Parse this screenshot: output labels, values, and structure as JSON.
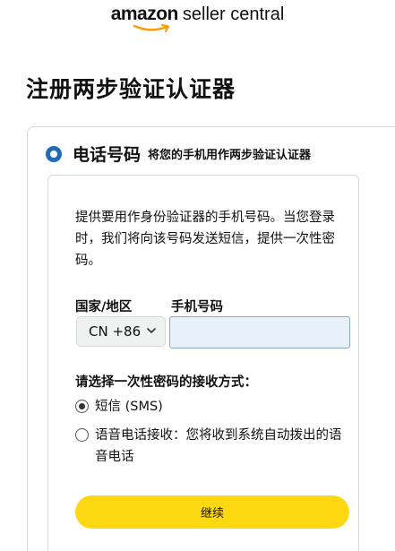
{
  "logo": {
    "brand": "amazon",
    "product": "seller central"
  },
  "page_title": "注册两步验证认证器",
  "phone_option": {
    "title": "电话号码",
    "subtitle": "将您的手机用作两步验证认证器",
    "selected": true
  },
  "intro_text": "提供要用作身份验证器的手机号码。当您登录时，我们将向该号码发送短信，提供一次性密码。",
  "country_label": "国家/地区",
  "phone_label": "手机号码",
  "country_select": {
    "value": "CN +86"
  },
  "phone_input": {
    "value": ""
  },
  "delivery_method": {
    "label": "请选择一次性密码的接收方式：",
    "options": [
      {
        "label": "短信 (SMS)",
        "selected": true
      },
      {
        "label": "语音电话接收：您将收到系统自动拨出的语音电话",
        "selected": false
      }
    ]
  },
  "continue_label": "继续",
  "colors": {
    "accent_blue": "#1f6bb8",
    "button_yellow": "#ffd814",
    "logo_orange": "#ff9900"
  }
}
